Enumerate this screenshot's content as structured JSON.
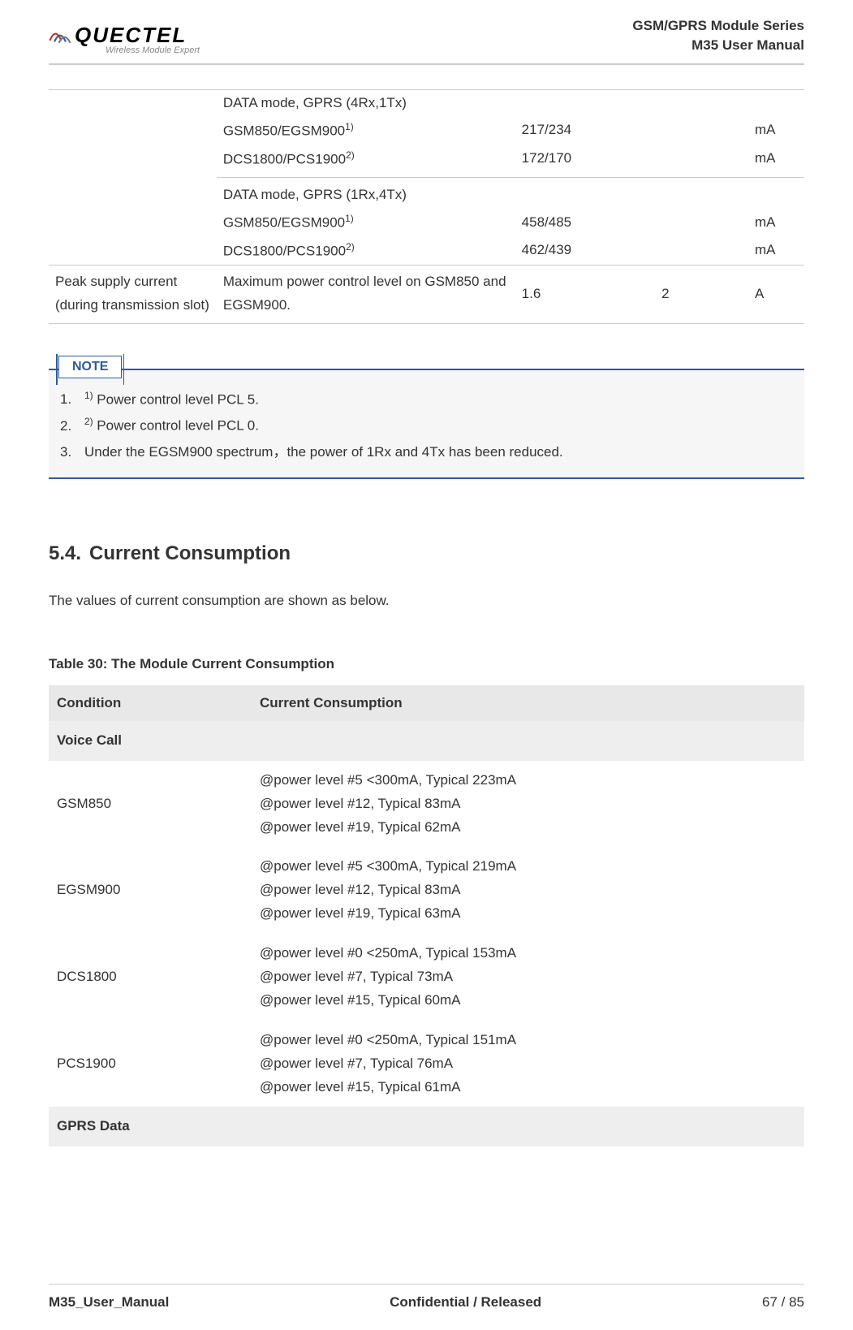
{
  "header": {
    "logo_text": "QUECTEL",
    "logo_sub": "Wireless Module Expert",
    "series": "GSM/GPRS  Module  Series",
    "manual": "M35  User  Manual"
  },
  "top_table": {
    "group1": {
      "title": "DATA mode, GPRS (4Rx,1Tx)",
      "row1_label": "GSM850/EGSM900",
      "row1_sup": "1)",
      "row1_typ": "217/234",
      "row1_unit": "mA",
      "row2_label": "DCS1800/PCS1900",
      "row2_sup": "2)",
      "row2_typ": "172/170",
      "row2_unit": "mA"
    },
    "group2": {
      "title": "DATA mode, GPRS (1Rx,4Tx)",
      "row1_label": "GSM850/EGSM900",
      "row1_sup": "1)",
      "row1_typ": "458/485",
      "row1_unit": "mA",
      "row2_label": "DCS1800/PCS1900",
      "row2_sup": "2)",
      "row2_typ": "462/439",
      "row2_unit": "mA"
    },
    "peak": {
      "desc": "Peak supply current (during transmission slot)",
      "cond": "Maximum power control level on GSM850 and EGSM900.",
      "typ": "1.6",
      "max": "2",
      "unit": "A"
    }
  },
  "note": {
    "label": "NOTE",
    "item1_num": "1.",
    "item1_sup": "1)",
    "item1_text": " Power control level PCL 5.",
    "item2_num": "2.",
    "item2_sup": "2)",
    "item2_text": " Power control level PCL 0.",
    "item3_num": "3.",
    "item3_text": "Under the EGSM900 spectrum，the power of 1Rx and 4Tx has been reduced."
  },
  "section": {
    "num": "5.4.",
    "title": "Current Consumption",
    "body": "The values of current consumption are shown as below."
  },
  "table30": {
    "caption": "Table 30: The Module Current Consumption",
    "head_cond": "Condition",
    "head_curr": "Current Consumption",
    "voice_call": "Voice Call",
    "gprs_data": "GPRS Data",
    "rows": {
      "gsm850": {
        "cond": "GSM850",
        "l1": "@power level #5 <300mA, Typical 223mA",
        "l2": "@power level #12, Typical 83mA",
        "l3": "@power level #19, Typical 62mA"
      },
      "egsm900": {
        "cond": "EGSM900",
        "l1": "@power level #5 <300mA, Typical 219mA",
        "l2": "@power level #12, Typical 83mA",
        "l3": "@power level #19, Typical 63mA"
      },
      "dcs1800": {
        "cond": "DCS1800",
        "l1": "@power level #0 <250mA, Typical 153mA",
        "l2": "@power level #7, Typical 73mA",
        "l3": "@power level #15, Typical 60mA"
      },
      "pcs1900": {
        "cond": "PCS1900",
        "l1": "@power level #0 <250mA, Typical 151mA",
        "l2": "@power level #7, Typical 76mA",
        "l3": "@power level #15, Typical 61mA"
      }
    }
  },
  "footer": {
    "left": "M35_User_Manual",
    "mid": "Confidential / Released",
    "right": "67 / 85"
  }
}
